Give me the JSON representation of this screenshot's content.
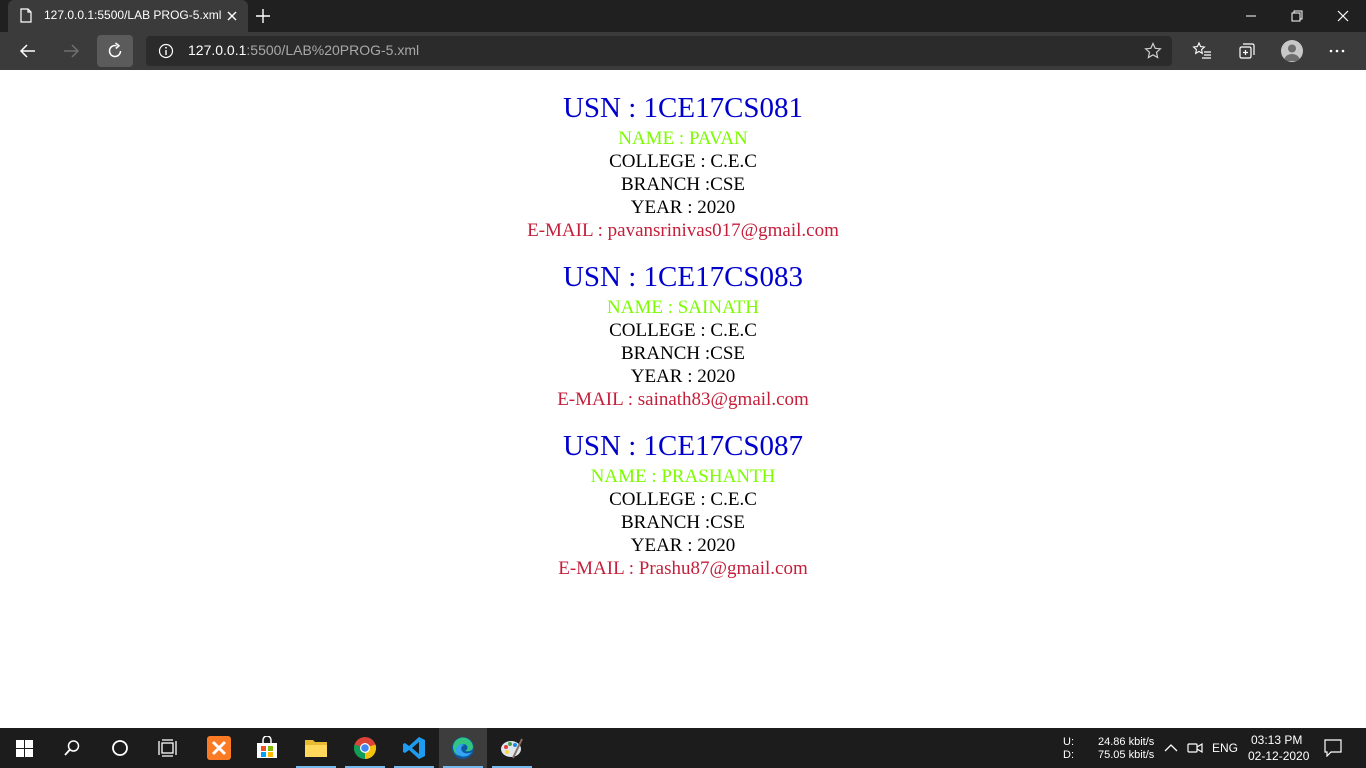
{
  "browser": {
    "tab_title": "127.0.0.1:5500/LAB PROG-5.xml",
    "url_host": "127.0.0.1",
    "url_rest": ":5500/LAB%20PROG-5.xml"
  },
  "records": [
    {
      "usn": "USN : 1CE17CS081",
      "name": "NAME : PAVAN",
      "college": "COLLEGE : C.E.C",
      "branch": "BRANCH :CSE",
      "year": "YEAR : 2020",
      "email": "E-MAIL : pavansrinivas017@gmail.com"
    },
    {
      "usn": "USN : 1CE17CS083",
      "name": "NAME : SAINATH",
      "college": "COLLEGE : C.E.C",
      "branch": "BRANCH :CSE",
      "year": "YEAR : 2020",
      "email": "E-MAIL : sainath83@gmail.com"
    },
    {
      "usn": "USN : 1CE17CS087",
      "name": "NAME : PRASHANTH",
      "college": "COLLEGE : C.E.C",
      "branch": "BRANCH :CSE",
      "year": "YEAR : 2020",
      "email": "E-MAIL : Prashu87@gmail.com"
    }
  ],
  "taskbar": {
    "upload_label": "U:",
    "download_label": "D:",
    "upload_speed": "24.86 kbit/s",
    "download_speed": "75.05 kbit/s",
    "language": "ENG",
    "time": "03:13 PM",
    "date": "02-12-2020"
  },
  "colors": {
    "usn": "#0000cd",
    "name": "#7cfc00",
    "email": "#c41e3a",
    "text": "#000000",
    "titlebar": "#202020",
    "toolbar": "#3b3b3b",
    "taskbar": "#1c1c1c"
  },
  "icons": [
    "page-icon",
    "close-icon",
    "plus-icon",
    "minimize-icon",
    "restore-icon",
    "back-icon",
    "forward-icon",
    "refresh-icon",
    "info-icon",
    "star-icon",
    "favorites-icon",
    "collections-icon",
    "profile-icon",
    "more-icon",
    "windows-icon",
    "search-icon",
    "cortana-icon",
    "task-view-icon",
    "xampp-icon",
    "store-icon",
    "file-explorer-icon",
    "chrome-icon",
    "vscode-icon",
    "edge-icon",
    "paint-icon",
    "chevron-up-icon",
    "meet-now-icon",
    "notification-icon"
  ]
}
